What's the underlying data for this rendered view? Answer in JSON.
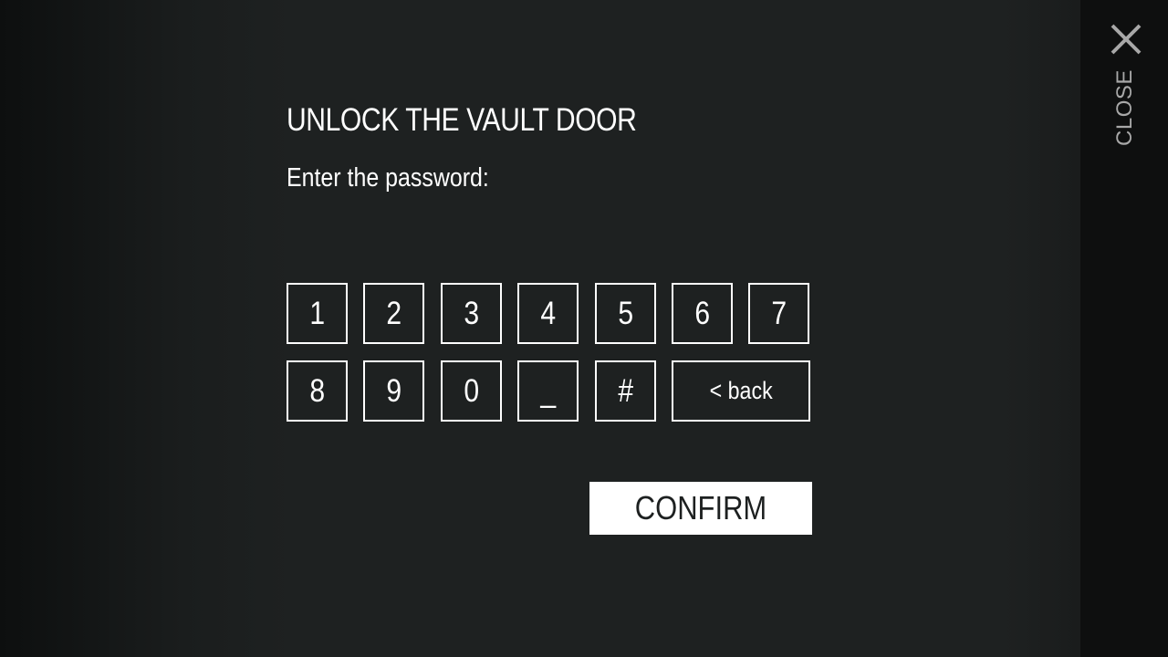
{
  "dialog": {
    "title": "UNLOCK THE VAULT DOOR",
    "prompt": "Enter the password:",
    "password_value": "",
    "keys": [
      "1",
      "2",
      "3",
      "4",
      "5",
      "6",
      "7",
      "8",
      "9",
      "0",
      "_",
      "#"
    ],
    "back_label": "< back",
    "confirm_label": "CONFIRM"
  },
  "sidebar": {
    "close_label": "CLOSE",
    "close_icon": "x-icon"
  },
  "colors": {
    "background": "#1e2121",
    "sidebar": "#0e0f0f",
    "text": "#ffffff",
    "close": "#a8a8a8"
  }
}
